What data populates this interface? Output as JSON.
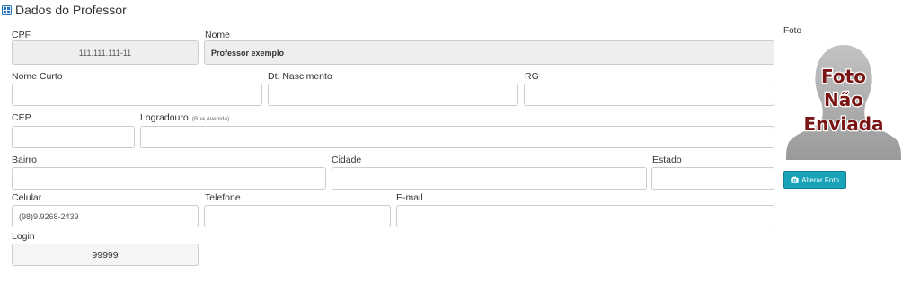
{
  "header": {
    "title": "Dados do Professor",
    "icon": "grid-icon"
  },
  "form": {
    "cpf": {
      "label": "CPF",
      "value": "111.111.111-11"
    },
    "nome": {
      "label": "Nome",
      "value": "Professor exemplo"
    },
    "nome_curto": {
      "label": "Nome Curto",
      "value": ""
    },
    "dt_nascimento": {
      "label": "Dt. Nascimento",
      "value": ""
    },
    "rg": {
      "label": "RG",
      "value": ""
    },
    "cep": {
      "label": "CEP",
      "value": ""
    },
    "logradouro": {
      "label": "Logradouro",
      "hint": "(Rua,Avenida)",
      "value": ""
    },
    "bairro": {
      "label": "Bairro",
      "value": ""
    },
    "cidade": {
      "label": "Cidade",
      "value": ""
    },
    "estado": {
      "label": "Estado",
      "value": ""
    },
    "celular": {
      "label": "Celular",
      "value": "(98)9.9268-2439"
    },
    "telefone": {
      "label": "Telefone",
      "value": ""
    },
    "email": {
      "label": "E-mail",
      "value": ""
    },
    "login": {
      "label": "Login",
      "value": "99999"
    }
  },
  "photo": {
    "label": "Foto",
    "placeholder_lines": [
      "Foto",
      "Não",
      "Enviada"
    ],
    "button_label": "Alterar Foto",
    "button_icon": "camera-icon",
    "text_color": "#7a1515",
    "button_color": "#17a2b8"
  }
}
